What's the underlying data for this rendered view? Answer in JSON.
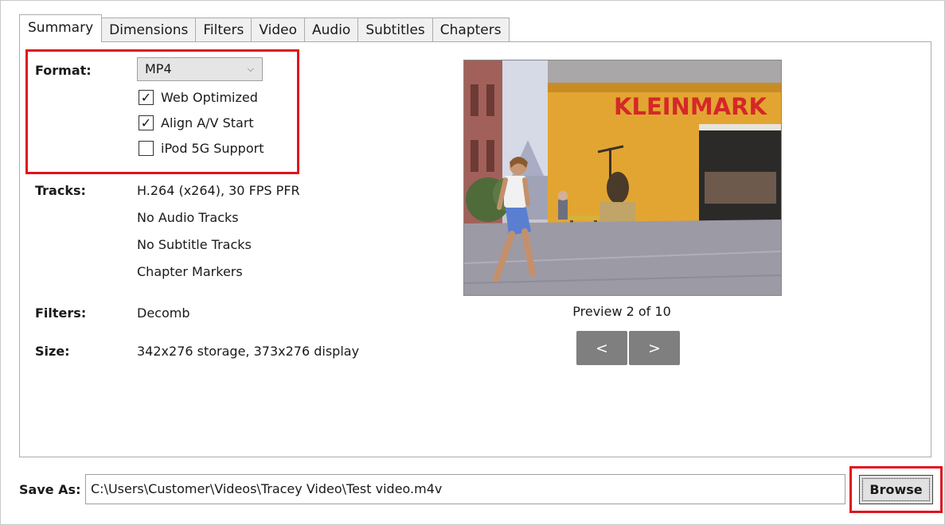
{
  "tabs": [
    "Summary",
    "Dimensions",
    "Filters",
    "Video",
    "Audio",
    "Subtitles",
    "Chapters"
  ],
  "active_tab": "Summary",
  "format": {
    "label": "Format:",
    "selected": "MP4",
    "options": {
      "web_optimized": {
        "label": "Web Optimized",
        "checked": true
      },
      "align_av": {
        "label": "Align A/V Start",
        "checked": true
      },
      "ipod": {
        "label": "iPod 5G Support",
        "checked": false
      }
    }
  },
  "tracks": {
    "label": "Tracks:",
    "items": [
      "H.264 (x264), 30 FPS PFR",
      "No Audio Tracks",
      "No Subtitle Tracks",
      "Chapter Markers"
    ]
  },
  "filters": {
    "label": "Filters:",
    "value": "Decomb"
  },
  "size": {
    "label": "Size:",
    "value": "342x276 storage, 373x276 display"
  },
  "preview": {
    "caption": "Preview 2 of 10",
    "prev": "<",
    "next": ">",
    "sign_text": "KLEINMARK"
  },
  "save": {
    "label": "Save As:",
    "path": "C:\\Users\\Customer\\Videos\\Tracey Video\\Test video.m4v",
    "browse": "Browse"
  },
  "colors": {
    "highlight": "#e0141e",
    "nav_button": "#7f7f7f"
  }
}
